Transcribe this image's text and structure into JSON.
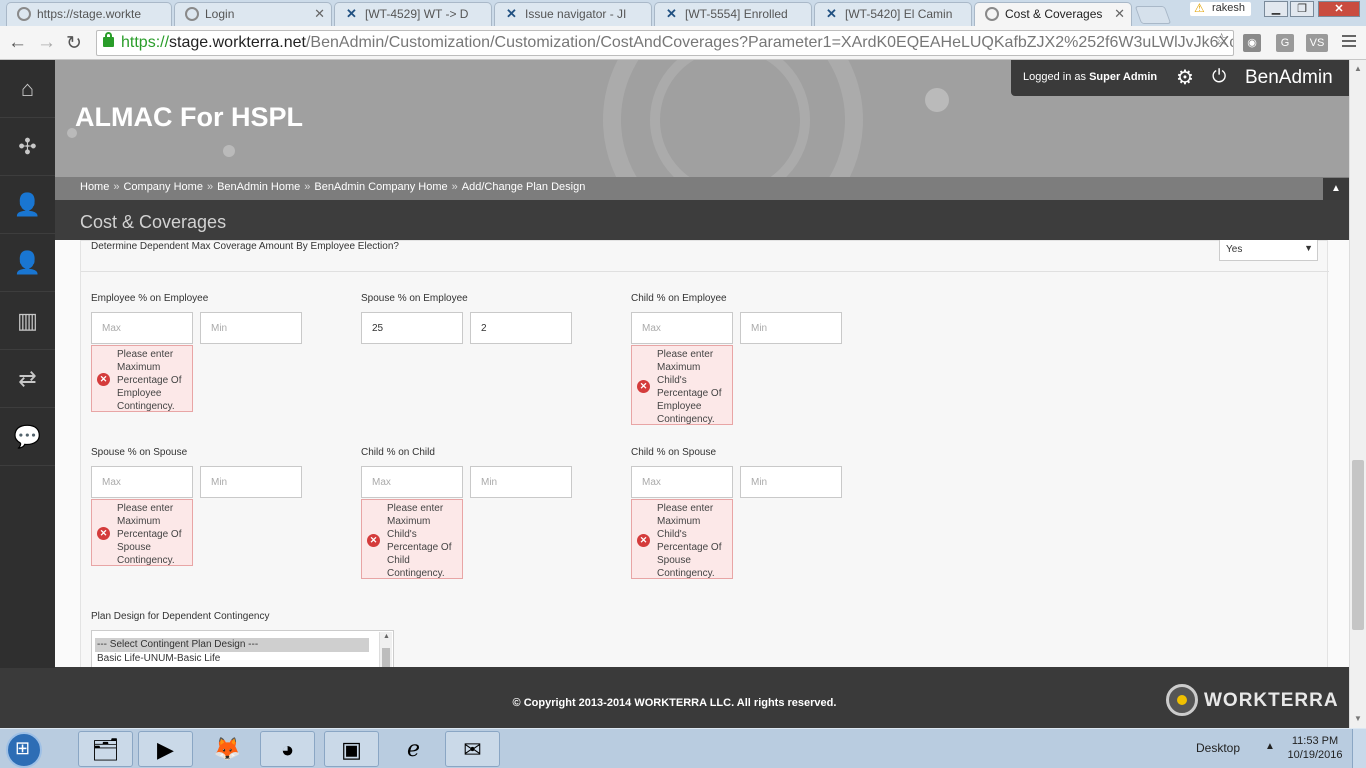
{
  "browser": {
    "tabs": [
      {
        "title": "https://stage.workte",
        "active": false,
        "icon": "globe-icon"
      },
      {
        "title": "Login",
        "active": false,
        "icon": "globe-icon"
      },
      {
        "title": "[WT-4529] WT -> D",
        "active": false,
        "icon": "jira-icon"
      },
      {
        "title": "Issue navigator - JI",
        "active": false,
        "icon": "jira-icon"
      },
      {
        "title": "[WT-5554] Enrolled",
        "active": false,
        "icon": "jira-icon"
      },
      {
        "title": "[WT-5420] El Camin",
        "active": false,
        "icon": "jira-icon"
      },
      {
        "title": "Cost & Coverages",
        "active": true,
        "icon": "globe-icon"
      }
    ],
    "profile_user": "rakesh",
    "url_scheme": "https://",
    "url_host": "stage.workterra.net",
    "url_path": "/BenAdmin/Customization/Customization/CostAndCoverages?Parameter1=XArdK0EQEAHeLUQKafbZJX2%252f6W3uLWlJvJk6Xc",
    "ext_g": "G",
    "ext_vs": "VS"
  },
  "header": {
    "company_title": "ALMAC For HSPL",
    "logged_in_prefix": "Logged in as",
    "logged_in_user": "Super Admin",
    "brand": "BenAdmin",
    "breadcrumb": [
      "Home",
      "Company Home",
      "BenAdmin Home",
      "BenAdmin Company Home",
      "Add/Change Plan Design"
    ],
    "breadcrumb_sep": "»"
  },
  "sidebar_icons": [
    "home-icon",
    "puzzle-icon",
    "user-star-icon",
    "user-icon",
    "bar-chart-icon",
    "transfer-icon",
    "chat-icon"
  ],
  "page": {
    "section_title": "Cost & Coverages",
    "question_label": "Determine Dependent Max Coverage Amount By Employee Election?",
    "question_value": "Yes",
    "fields": [
      {
        "label": "Employee % on Employee",
        "max_placeholder": "Max",
        "min_placeholder": "Min",
        "max_value": "",
        "min_value": "",
        "error": "Please enter Maximum Percentage Of Employee Contingency."
      },
      {
        "label": "Spouse % on Employee",
        "max_placeholder": "Max",
        "min_placeholder": "Min",
        "max_value": "25",
        "min_value": "2",
        "error": ""
      },
      {
        "label": "Child % on Employee",
        "max_placeholder": "Max",
        "min_placeholder": "Min",
        "max_value": "",
        "min_value": "",
        "error": "Please enter Maximum Child's Percentage Of Employee Contingency."
      },
      {
        "label": "Spouse % on Spouse",
        "max_placeholder": "Max",
        "min_placeholder": "Min",
        "max_value": "",
        "min_value": "",
        "error": "Please enter Maximum Percentage Of Spouse Contingency."
      },
      {
        "label": "Child % on Child",
        "max_placeholder": "Max",
        "min_placeholder": "Min",
        "max_value": "",
        "min_value": "",
        "error": "Please enter Maximum Child's Percentage Of Child Contingency."
      },
      {
        "label": "Child % on Spouse",
        "max_placeholder": "Max",
        "min_placeholder": "Min",
        "max_value": "",
        "min_value": "",
        "error": "Please enter Maximum Child's Percentage Of Spouse Contingency."
      }
    ],
    "plan_design_label": "Plan Design for Dependent Contingency",
    "plan_design_options": [
      "--- Select Contingent Plan Design ---",
      "Basic Life-UNUM-Basic Life"
    ]
  },
  "footer": {
    "copyright": "© Copyright 2013-2014 WORKTERRA LLC. All rights reserved.",
    "logo_text": "WORKTERRA"
  },
  "taskbar": {
    "desktop_label": "Desktop",
    "time": "11:53 PM",
    "date": "10/19/2016"
  }
}
